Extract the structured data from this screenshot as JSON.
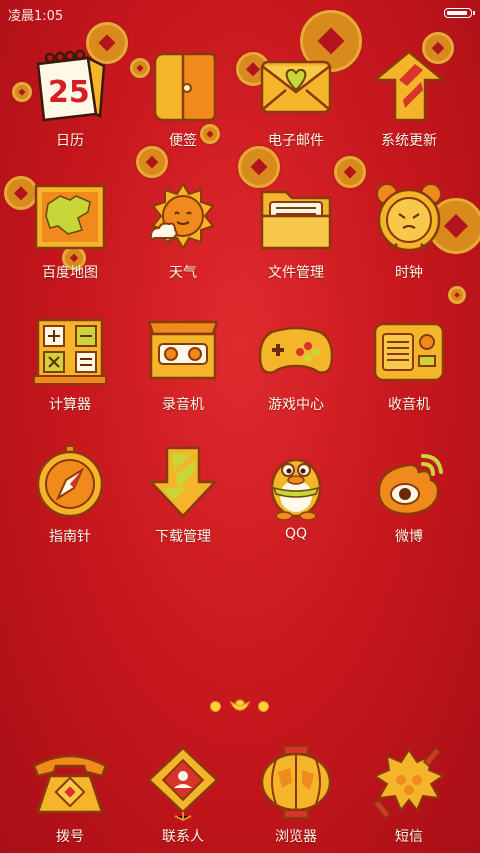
{
  "status": {
    "time": "凌晨1:05"
  },
  "apps": [
    {
      "label": "日历",
      "icon": "calendar-icon",
      "date_text": "25"
    },
    {
      "label": "便签",
      "icon": "notes-wallet-icon"
    },
    {
      "label": "电子邮件",
      "icon": "envelope-heart-icon"
    },
    {
      "label": "系统更新",
      "icon": "update-arrow-icon"
    },
    {
      "label": "百度地图",
      "icon": "map-icon"
    },
    {
      "label": "天气",
      "icon": "sun-cloud-icon"
    },
    {
      "label": "文件管理",
      "icon": "folder-icon"
    },
    {
      "label": "时钟",
      "icon": "alarm-clock-icon"
    },
    {
      "label": "计算器",
      "icon": "abacus-icon"
    },
    {
      "label": "录音机",
      "icon": "cassette-icon"
    },
    {
      "label": "游戏中心",
      "icon": "gamepad-icon"
    },
    {
      "label": "收音机",
      "icon": "radio-icon"
    },
    {
      "label": "指南针",
      "icon": "compass-icon"
    },
    {
      "label": "下载管理",
      "icon": "download-arrow-icon"
    },
    {
      "label": "QQ",
      "icon": "penguin-icon"
    },
    {
      "label": "微博",
      "icon": "weibo-eye-icon"
    }
  ],
  "dock": [
    {
      "label": "拨号",
      "icon": "telephone-icon"
    },
    {
      "label": "联系人",
      "icon": "chinese-knot-icon"
    },
    {
      "label": "浏览器",
      "icon": "lantern-globe-icon"
    },
    {
      "label": "短信",
      "icon": "firecracker-icon"
    }
  ],
  "page_indicator": {
    "pages": 2,
    "current": 1
  },
  "colors": {
    "background": "#c4161c",
    "icon_gold": "#f4b52a",
    "icon_orange": "#f08a1c",
    "outline": "#8a3a0a"
  }
}
